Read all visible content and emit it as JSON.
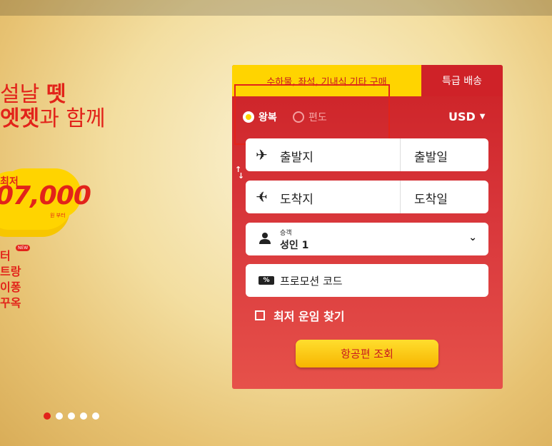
{
  "promo": {
    "line1_pre": "설날 ",
    "line1_bold": "뗏",
    "line2_bold": "엣젯",
    "line2_rest": "과 함께",
    "price_label": "최저",
    "price_value": "07,000",
    "price_suffix": "원 부터",
    "destinations": [
      "터",
      "트랑",
      "이퐁",
      "꾸옥"
    ],
    "new_badge": "NEW"
  },
  "booking": {
    "tabs": {
      "extras": "수하물, 좌석, 기내식 기타 구매",
      "express": "특급 배송"
    },
    "trip_type": {
      "round_trip": "왕복",
      "one_way": "편도",
      "selected": "왕복"
    },
    "currency": "USD",
    "origin_label": "출발지",
    "depart_date_label": "출발일",
    "destination_label": "도착지",
    "return_date_label": "도착일",
    "passengers": {
      "caption": "승객",
      "value": "성인 1"
    },
    "promo_code_label": "프로모션 코드",
    "promo_icon_text": "%",
    "lowest_fare_label": "최저 운임 찾기",
    "search_button": "항공편 조회"
  },
  "carousel": {
    "count": 5,
    "active": 0
  },
  "colors": {
    "brand_red": "#e2231a",
    "brand_yellow": "#ffd400"
  }
}
